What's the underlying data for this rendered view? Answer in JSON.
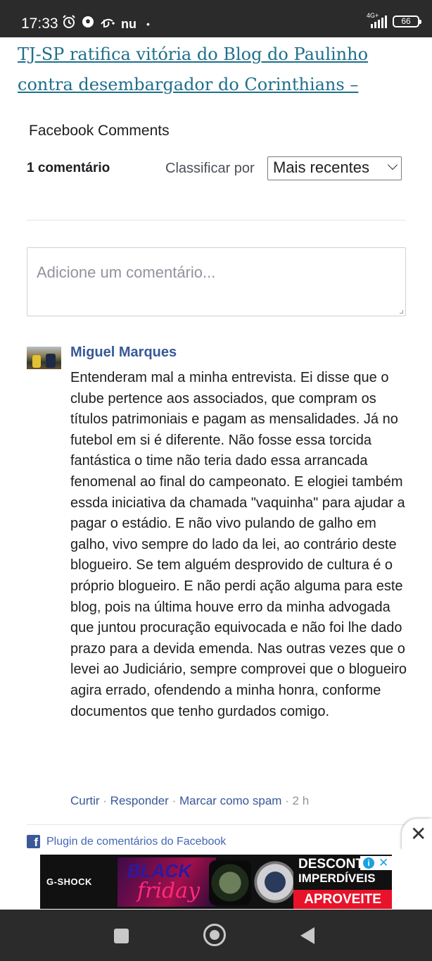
{
  "status_bar": {
    "time": "17:33",
    "network": "4G+",
    "battery": "66",
    "app_icons": [
      "alarm-icon",
      "soccer-ball-icon",
      "disney-plus-icon",
      "nubank-icon"
    ],
    "nu_text": "nu",
    "dot": "•"
  },
  "article": {
    "link_text": "TJ-SP ratifica vitória do Blog do Paulinho contra desembargador do Corinthians –"
  },
  "facebook": {
    "title": "Facebook Comments",
    "comment_count": "1 comentário",
    "sort_label": "Classificar por",
    "sort_value": "Mais recentes",
    "comment_placeholder": "Adicione um comentário...",
    "plugin_label": "Plugin de comentários do Facebook"
  },
  "comment": {
    "author": "Miguel Marques",
    "text": "Entenderam mal a minha entrevista. Ei disse que o clube pertence aos associados, que compram os títulos patrimoniais e pagam as mensalidades. Já no futebol em si é diferente. Não fosse essa torcida fantástica o time não teria dado essa arrancada fenomenal ao final do campeonato. E elogiei também essda iniciativa da chamada \"vaquinha\" para ajudar a pagar o estádio. E não vivo pulando de galho em galho, vivo sempre do lado da lei, ao contrário deste blogueiro. Se tem alguém desprovido de cultura é o próprio blogueiro. E não perdi ação alguma para este blog, pois na última houve erro da minha advogada que juntou procuração equivocada e não foi lhe dado prazo para a devida emenda. Nas outras vezes que o levei ao Judiciário, sempre comprovei que o blogueiro agira errado, ofendendo a minha honra, conforme documentos que tenho gurdados comigo.",
    "like": "Curtir",
    "reply": "Responder",
    "spam": "Marcar como spam",
    "separator": " · ",
    "time": "2 h"
  },
  "ad": {
    "brand": "G-SHOCK",
    "black": "BLACK",
    "friday": "friday",
    "desc_line1": "DESCONTOS",
    "desc_line2": "IMPERDÍVEIS",
    "cta": "APROVEITE",
    "info_icon": "i",
    "close_icon": "✕"
  },
  "close_button": "✕",
  "colors": {
    "link": "#1f6f8b",
    "fb_blue": "#385898",
    "status_bar": "#2b2b2b"
  }
}
